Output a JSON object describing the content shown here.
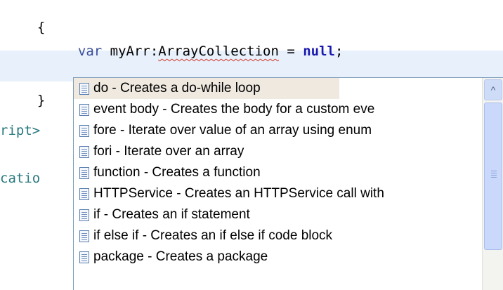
{
  "editor": {
    "line1": "{",
    "line2_kw": "var",
    "line2_rest": " myArr:",
    "line2_type": "ArrayCollection",
    "line2_eq": " = ",
    "line2_null": "null",
    "line2_end": ";",
    "line3": "}",
    "left_line_a": "ript>",
    "left_line_b": "catio"
  },
  "completion": {
    "items": [
      {
        "label": "do - Creates a do-while loop",
        "icon": "template-icon"
      },
      {
        "label": "event body - Creates the body for a custom eve",
        "icon": "template-icon"
      },
      {
        "label": "fore - Iterate over value of an array using enum",
        "icon": "template-icon"
      },
      {
        "label": "fori - Iterate over an array",
        "icon": "template-icon"
      },
      {
        "label": "function - Creates a function",
        "icon": "template-icon"
      },
      {
        "label": "HTTPService - Creates an HTTPService call with",
        "icon": "template-icon"
      },
      {
        "label": "if - Creates an if statement",
        "icon": "template-icon"
      },
      {
        "label": "if else if - Creates an if else if code block",
        "icon": "template-icon"
      },
      {
        "label": "package - Creates a package",
        "icon": "template-icon"
      }
    ],
    "scroll_up_glyph": "^"
  },
  "colors": {
    "highlight_line": "#e8f0fb",
    "selection": "#efe9e0",
    "keyword": "#3a4f9a",
    "null_keyword": "#1a1ab0",
    "error_squiggle": "#d23a2a"
  }
}
